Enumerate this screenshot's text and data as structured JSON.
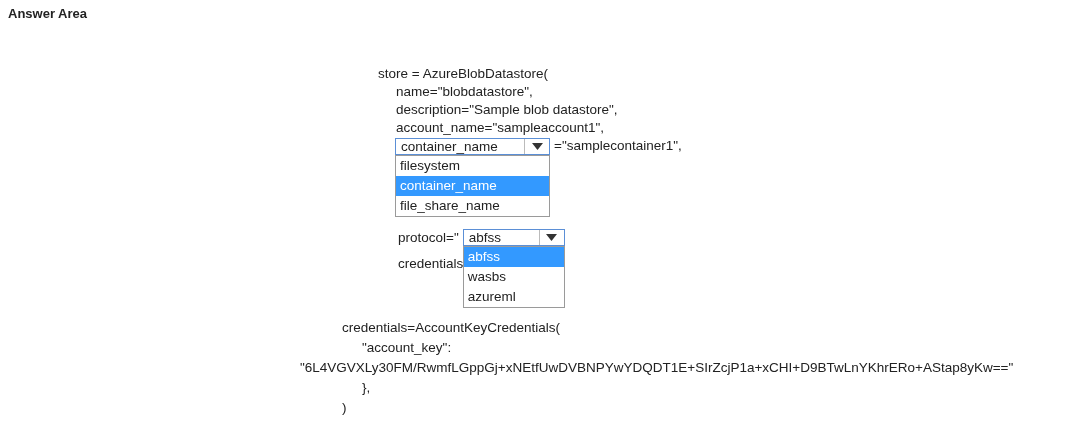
{
  "title": "Answer Area",
  "code": {
    "opening": "store = AzureBlobDatastore(",
    "args": [
      "name=\"blobdatastore\",",
      "description=\"Sample blob datastore\",",
      "account_name=\"sampleaccount1\","
    ],
    "container_select": {
      "value": "container_name",
      "expanded": true,
      "options": [
        {
          "label": "filesystem",
          "selected": false
        },
        {
          "label": "container_name",
          "selected": true
        },
        {
          "label": "file_share_name",
          "selected": false
        }
      ]
    },
    "container_suffix": "=\"samplecontainer1\",",
    "protocol_prefix": "protocol=\"",
    "protocol_select": {
      "value": "abfss",
      "expanded": true,
      "options": [
        {
          "label": "abfss",
          "selected": true
        },
        {
          "label": "wasbs",
          "selected": false
        },
        {
          "label": "azureml",
          "selected": false
        }
      ]
    },
    "credentials_partial": "credentials",
    "credentials_block": [
      {
        "kind": "outer",
        "text": "credentials=AccountKeyCredentials("
      },
      {
        "kind": "inner",
        "text": "\"account_key\":"
      },
      {
        "kind": "wide",
        "text": "\"6L4VGVXLy30FM/RwmfLGppGj+xNEtfUwDVBNPYwYDQDT1E+SIrZcjP1a+xCHI+D9BTwLnYKhrERo+AStap8yKw==\""
      },
      {
        "kind": "inner",
        "text": "},"
      },
      {
        "kind": "outer",
        "text": ")"
      }
    ]
  }
}
